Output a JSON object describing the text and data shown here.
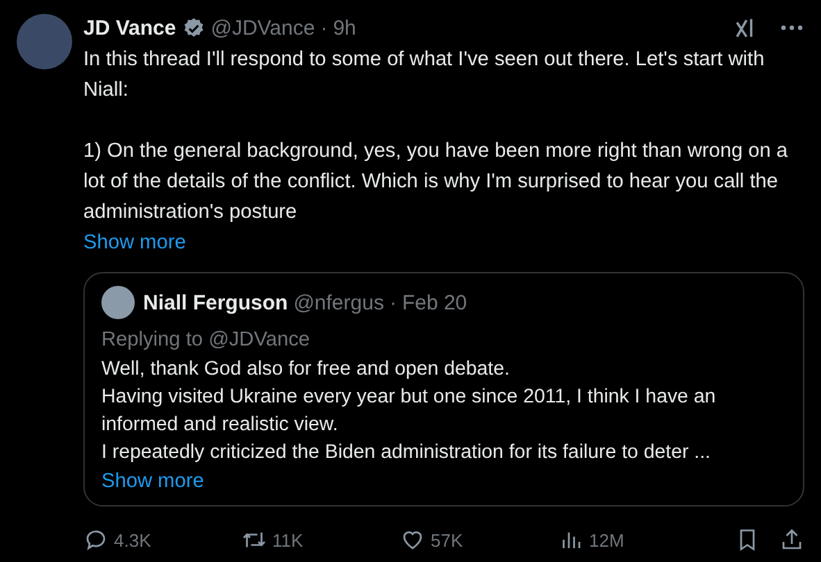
{
  "tweet": {
    "name": "JD Vance",
    "verified": true,
    "handle": "@JDVance",
    "separator": "·",
    "time": "9h",
    "paragraphs": [
      "In this thread I'll respond to some of what I've seen out there. Let's start with Niall:",
      "1) On the general background, yes, you have been more right than wrong on a lot of the details of the conflict. Which is why I'm surprised to hear you call the administration's posture"
    ],
    "show_more": "Show more",
    "quote": {
      "name": "Niall Ferguson",
      "handle": "@nfergus",
      "separator": "·",
      "time": "Feb 20",
      "replying_to": "Replying to @JDVance",
      "lines": [
        "Well, thank God also for free and open debate.",
        "Having visited Ukraine every year but one since 2011, I think I have an informed and realistic view.",
        "I repeatedly criticized the Biden administration for its failure to deter ..."
      ],
      "show_more": "Show more"
    },
    "actions": [
      {
        "kind": "reply",
        "count": "4.3K"
      },
      {
        "kind": "repost",
        "count": "11K"
      },
      {
        "kind": "like",
        "count": "57K"
      },
      {
        "kind": "views",
        "count": "12M"
      }
    ]
  }
}
